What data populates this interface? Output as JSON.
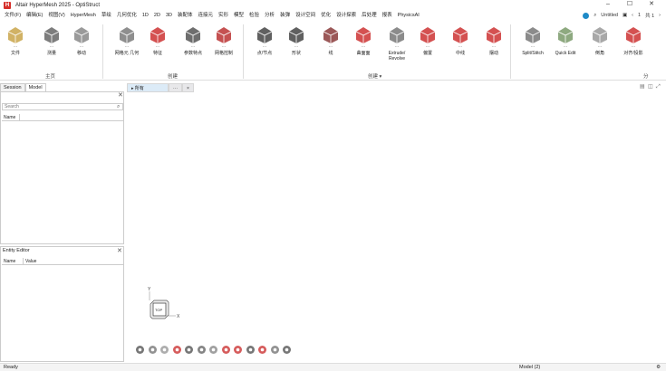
{
  "app": {
    "title": "Altair HyperMesh 2025 - OptiStruct",
    "logo_text": "H"
  },
  "window_controls": {
    "minimize": "–",
    "maximize": "☐",
    "close": "✕"
  },
  "menu": [
    "文件(F)",
    "编辑(E)",
    "视图(V)",
    "HyperMesh",
    "草绘",
    "几何优化",
    "1D",
    "2D",
    "3D",
    "装配体",
    "连接元",
    "实形",
    "模型",
    "检验",
    "分析",
    "装弹",
    "设计空间",
    "优化",
    "设计探索",
    "后处理",
    "报表",
    "PhysicsAI"
  ],
  "menu_active_index": 5,
  "menu_right": {
    "model_name": "Untitled",
    "page": "1",
    "of_total": "共 1"
  },
  "ribbon": {
    "tools": [
      {
        "label": "文件",
        "name": "file"
      },
      {
        "label": "测量",
        "name": "measure"
      },
      {
        "label": "移动",
        "name": "move"
      },
      {
        "label": "网格元 几何",
        "name": "mesh-geometry"
      },
      {
        "label": "特征",
        "name": "feature"
      },
      {
        "label": "参数特点",
        "name": "param"
      },
      {
        "label": "网格控制",
        "name": "mesh-control"
      },
      {
        "label": "点/节点",
        "name": "points-nodes"
      },
      {
        "label": "形状",
        "name": "shape"
      },
      {
        "label": "线",
        "name": "line"
      },
      {
        "label": "曲面面",
        "name": "surface"
      },
      {
        "label": "Extrude/\nRevolve",
        "name": "extrude-revolve"
      },
      {
        "label": "偏置",
        "name": "offset"
      },
      {
        "label": "中线",
        "name": "midline"
      },
      {
        "label": "摆动",
        "name": "swing"
      },
      {
        "label": "Split/Stitch",
        "name": "split-stitch"
      },
      {
        "label": "Quick Edit",
        "name": "quick-edit"
      },
      {
        "label": "倒角",
        "name": "chamfer"
      },
      {
        "label": "对齐/投影",
        "name": "align-project"
      }
    ],
    "groups": {
      "home": "主页",
      "create1": "创建",
      "create2": "创建 ▾",
      "more": "分"
    }
  },
  "left_panel": {
    "tabs": [
      "Session",
      "Model"
    ],
    "search_placeholder": "Search",
    "columns": [
      "Name"
    ]
  },
  "entity_editor": {
    "title": "Entity Editor",
    "columns": [
      "Name",
      "Value"
    ]
  },
  "viewport": {
    "tabs": [
      {
        "label": "▸ 所有"
      },
      {
        "label": "···"
      },
      {
        "label": "×"
      }
    ],
    "view_cube_label": "TOP",
    "axis_y": "Y",
    "axis_x": "X"
  },
  "status": {
    "ready": "Ready",
    "model": "Model (2)"
  },
  "colors": {
    "accent_red": "#d13a2f",
    "blue": "#1f8ac7"
  }
}
